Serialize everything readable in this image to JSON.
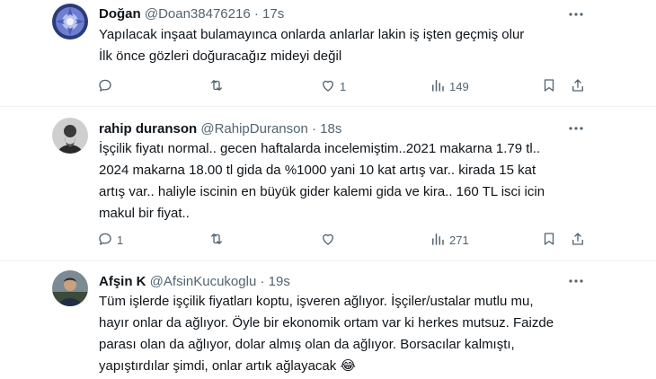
{
  "tweets": [
    {
      "name": "Doğan",
      "handle": "@Doan38476216",
      "dot": "·",
      "time": "17s",
      "lines": [
        "Yapılacak inşaat bulamayınca onlarda anlarlar lakin iş işten geçmiş olur",
        "İlk önce gözleri doğuracağız mideyi değil"
      ],
      "replies": "",
      "retweets": "",
      "likes": "1",
      "views": "149"
    },
    {
      "name": "rahip duranson",
      "handle": "@RahipDuranson",
      "dot": "·",
      "time": "18s",
      "lines": [
        "İşçilik fiyatı normal.. gecen haftalarda incelemiştim..2021 makarna 1.79 tl..",
        "2024 makarna 18.00 tl gida da %1000 yani 10 kat artış var.. kirada 15 kat",
        "artış var.. haliyle iscinin en büyük gider kalemi gida ve kira.. 160 TL isci icin",
        "makul bir fiyat.."
      ],
      "replies": "1",
      "retweets": "",
      "likes": "",
      "views": "271"
    },
    {
      "name": "Afşin K",
      "handle": "@AfsinKucukoglu",
      "dot": "·",
      "time": "19s",
      "lines": [
        "Tüm işlerde işçilik fiyatları koptu,  işveren ağlıyor. İşçiler/ustalar mutlu mu,",
        "hayır onlar da ağlıyor. Öyle bir ekonomik ortam var ki herkes mutsuz. Faizde",
        "parası olan da ağlıyor, dolar almış olan da ağlıyor. Borsacılar kalmıştı,",
        "yapıştırdılar şimdi, onlar artık ağlayacak 😂"
      ]
    }
  ],
  "colors": {
    "text": "#0f1419",
    "secondary": "#536471",
    "border": "#eff3f4"
  }
}
